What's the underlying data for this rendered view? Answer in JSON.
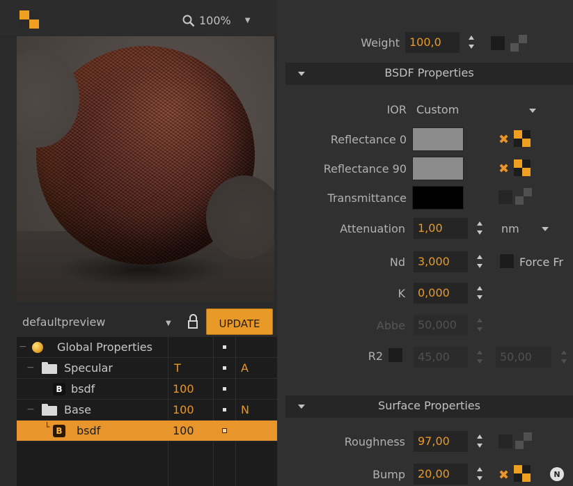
{
  "toolbar": {
    "zoom": "100%"
  },
  "preview_panel": {
    "scene": "defaultpreview",
    "update_label": "UPDATE"
  },
  "tree": {
    "rows": [
      {
        "label": "Global Properties",
        "value": "",
        "flag": ""
      },
      {
        "label": "Specular",
        "value": "T",
        "flag": "A"
      },
      {
        "label": "bsdf",
        "value": "100",
        "flag": "",
        "badge": "B"
      },
      {
        "label": "Base",
        "value": "100",
        "flag": "N"
      },
      {
        "label": "bsdf",
        "value": "100",
        "flag": "",
        "badge": "B"
      }
    ]
  },
  "properties": {
    "weight": {
      "label": "Weight",
      "value": "100,0"
    },
    "bsdf_section": "BSDF Properties",
    "ior": {
      "label": "IOR",
      "value": "Custom"
    },
    "reflectance0": {
      "label": "Reflectance 0",
      "color": "#8c8c8c"
    },
    "reflectance90": {
      "label": "Reflectance 90",
      "color": "#8c8c8c"
    },
    "transmittance": {
      "label": "Transmittance",
      "color": "#000000"
    },
    "attenuation": {
      "label": "Attenuation",
      "value": "1,00",
      "unit": "nm"
    },
    "nd": {
      "label": "Nd",
      "value": "3,000",
      "force_label": "Force Fr"
    },
    "k": {
      "label": "K",
      "value": "0,000"
    },
    "abbe": {
      "label": "Abbe",
      "value": "50,000"
    },
    "r2": {
      "label": "R2",
      "value1": "45,00",
      "value2": "50,00"
    },
    "surface_section": "Surface Properties",
    "roughness": {
      "label": "Roughness",
      "value": "97,00"
    },
    "bump": {
      "label": "Bump",
      "value": "20,00",
      "n_badge": "N"
    }
  },
  "colors": {
    "accent": "#e8962b",
    "background": "#303030"
  }
}
